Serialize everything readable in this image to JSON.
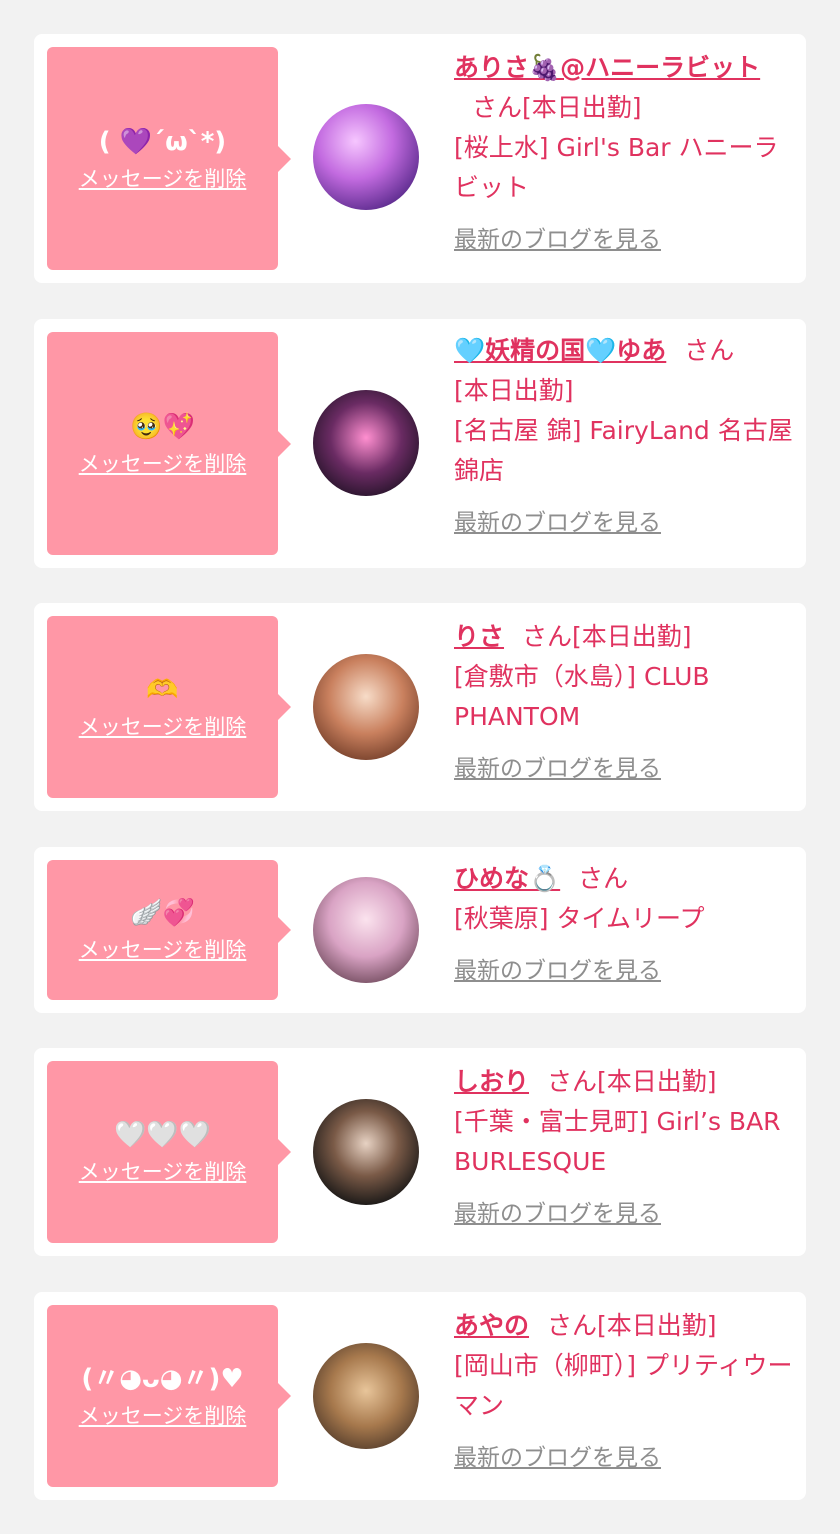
{
  "delete_label": "メッセージを削除",
  "blog_label": "最新のブログを見る",
  "honorific": "さん",
  "accent_color": "#e0325f",
  "bubble_color": "#ff97a6",
  "cards": [
    {
      "message": "( 💜´ω`*)",
      "name": "ありさ🍇@ハニーラビット",
      "status": "[本日出勤]",
      "shop": "[桜上水] Girl's Bar ハニーラビット"
    },
    {
      "message": "🥹💖",
      "name": "🩵妖精の国🩵ゆあ",
      "status": "[本日出勤]",
      "shop": "[名古屋 錦] FairyLand 名古屋錦店"
    },
    {
      "message": "🫶",
      "name": "りさ",
      "status": "[本日出勤]",
      "shop": "[倉敷市（水島）] CLUB PHANTOM"
    },
    {
      "message": "🪽💞",
      "name": "ひめな💍",
      "status": "",
      "shop": "[秋葉原] タイムリープ"
    },
    {
      "message": "🤍🤍🤍",
      "name": "しおり",
      "status": "[本日出勤]",
      "shop": "[千葉・富士見町] Girl’s BAR BURLESQUE"
    },
    {
      "message": "(〃◕ᴗ◕〃)♥",
      "name": "あやの",
      "status": "[本日出勤]",
      "shop": "[岡山市（柳町）] プリティウーマン"
    }
  ]
}
